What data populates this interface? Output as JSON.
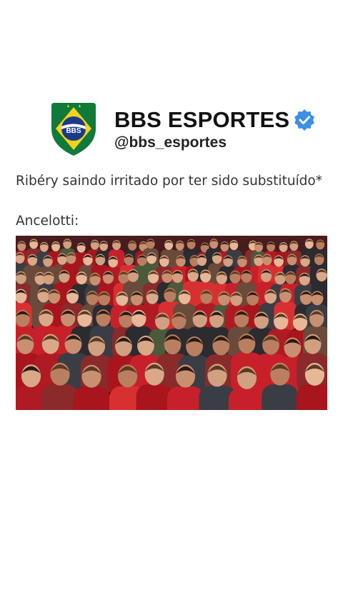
{
  "account": {
    "name": "BBS ESPORTES",
    "handle": "@bbs_esportes",
    "logo_text": "BBS",
    "verified_icon": "verified-badge-icon",
    "verified_color": "#3b8fe6"
  },
  "post": {
    "text": "Ribéry saindo irritado por ter sido substituído*",
    "subtext": "Ancelotti:"
  },
  "media": {
    "description_icon": "stadium-crowd-image"
  },
  "colors": {
    "logo_green": "#0f7a3a",
    "logo_yellow": "#f3d21a",
    "logo_blue": "#1b3a8a",
    "crowd_red": "#c8202a"
  }
}
